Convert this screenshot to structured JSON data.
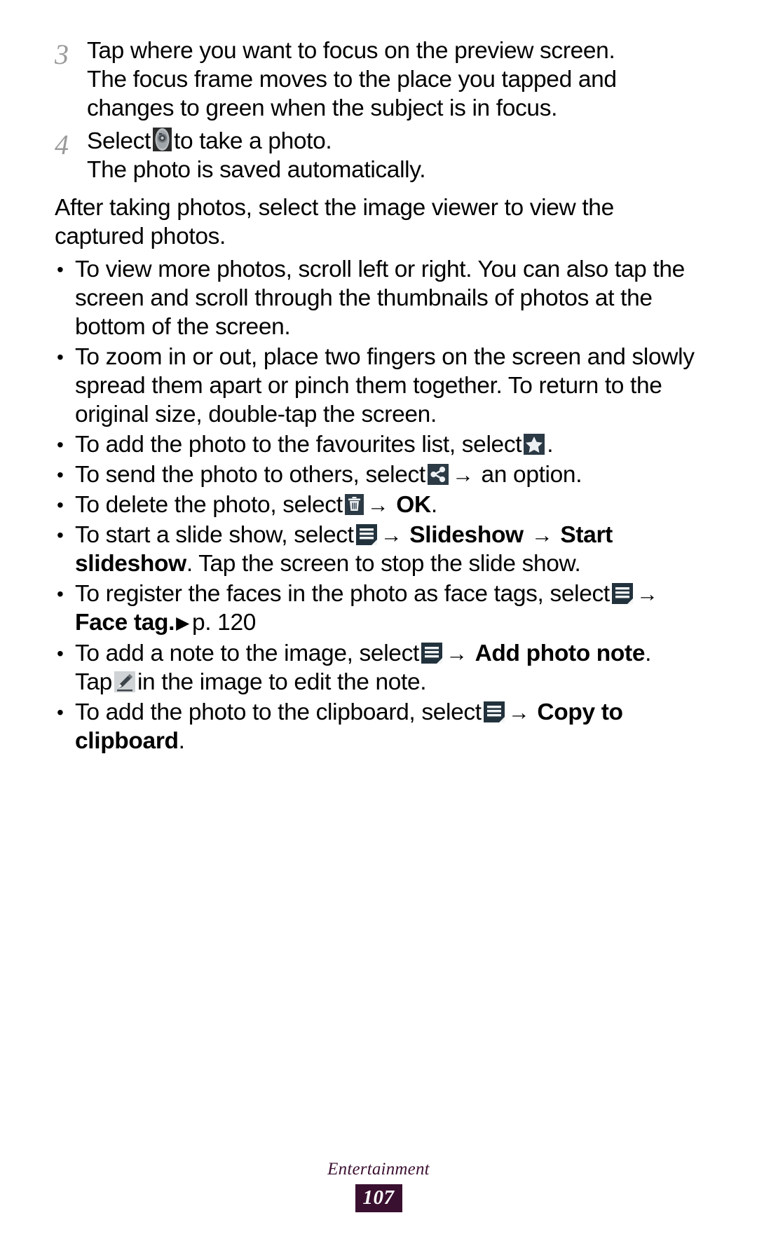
{
  "document": {
    "steps": [
      {
        "number": "3",
        "line1": "Tap where you want to focus on the preview screen.",
        "line2": "The focus frame moves to the place you tapped and",
        "line3": "changes to green when the subject is in focus."
      },
      {
        "number": "4",
        "select_label": "Select",
        "icon": "camera-shutter-icon",
        "after_icon": "to take a photo.",
        "line2": "The photo is saved automatically."
      }
    ],
    "intro_paragraph": "After taking photos, select the image viewer to view the captured photos.",
    "bullet_char": "•",
    "arrow_char": "→",
    "triangle_char": "▶",
    "bullets": [
      {
        "id": "view-more-photos",
        "text": "To view more photos, scroll left or right. You can also tap the screen and scroll through the thumbnails of photos at the bottom of the screen."
      },
      {
        "id": "zoom-in-out",
        "text": "To zoom in or out, place two fingers on the screen and slowly spread them apart or pinch them together. To return to the original size, double-tap the screen."
      },
      {
        "id": "add-to-favourites",
        "pre": "To add the photo to the favourites list, select",
        "icon": "star-icon",
        "post": "."
      },
      {
        "id": "send-photo",
        "pre": "To send the photo to others, select",
        "icon": "share-icon",
        "post": "an option."
      },
      {
        "id": "delete-photo",
        "pre": "To delete the photo, select",
        "icon": "trash-icon",
        "bold_after": "OK",
        "post": "."
      },
      {
        "id": "start-slideshow",
        "pre": "To start a slide show, select",
        "icon": "menu-icon",
        "bold_after": "Slideshow",
        "bold_second": "Start slideshow",
        "tail": ". Tap the screen to stop the slide show."
      },
      {
        "id": "face-tag",
        "pre": "To register the faces in the photo as face tags, select",
        "icon": "menu-icon",
        "bold_after": "Face tag.",
        "page_ref": "p. 120"
      },
      {
        "id": "add-photo-note",
        "pre": "To add a note to the image, select",
        "icon": "menu-icon",
        "bold_after": "Add photo note",
        "tail_pre": ".",
        "tap_label": "Tap",
        "tap_icon": "pencil-edit-icon",
        "tap_post": "in the image to edit the note."
      },
      {
        "id": "copy-to-clipboard",
        "pre": "To add the photo to the clipboard, select",
        "icon": "menu-icon",
        "bold_after": "Copy to clipboard",
        "post": "."
      }
    ],
    "footer": {
      "section": "Entertainment",
      "page_number": "107"
    },
    "colors": {
      "page_accent": "#3a1030",
      "section_text": "#3d1233",
      "step_number": "#9a9a9a",
      "icon_dark": "#20303a",
      "icon_light": "#c9cdd0"
    }
  }
}
